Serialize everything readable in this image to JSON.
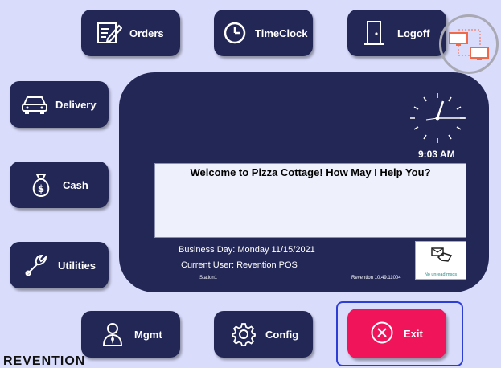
{
  "nav": {
    "orders": "Orders",
    "timeclock": "TimeClock",
    "logoff": "Logoff",
    "delivery": "Delivery",
    "cash": "Cash",
    "utilities": "Utilities",
    "mgmt": "Mgmt",
    "config": "Config",
    "exit": "Exit"
  },
  "clock": {
    "time": "9:03 AM"
  },
  "welcome": "Welcome to Pizza Cottage! How May I Help You?",
  "info": {
    "business_day": "Business Day: Monday 11/15/2021",
    "current_user": "Current User: Revention POS",
    "station": "Station1",
    "version": "Revention 10.49.11004"
  },
  "messages": {
    "status": "No unread msgs"
  },
  "brand": {
    "logo": "REVENTION"
  },
  "colors": {
    "background": "#d9dcfb",
    "button": "#232756",
    "exit": "#f0155b",
    "highlight": "#2d3ed6"
  }
}
